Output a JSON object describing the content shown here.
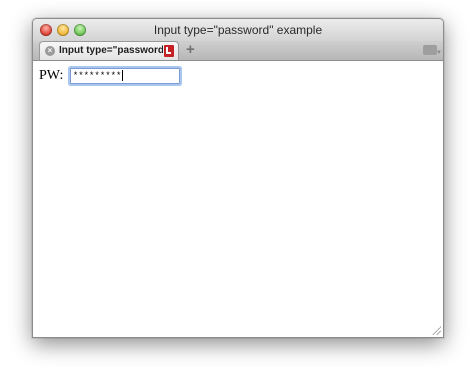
{
  "window": {
    "title": "Input type=\"password\" example"
  },
  "tabs": [
    {
      "label": "Input type=\"password...",
      "close_glyph": "×",
      "favicon": "bookmark-icon"
    }
  ],
  "tabstrip": {
    "new_tab_glyph": "+",
    "menu_icon": "tab-overview-icon"
  },
  "form": {
    "password_label": "PW:",
    "password_value": "*********"
  },
  "colors": {
    "focus_ring": "#a9c6ef",
    "close_light": "#e0443a",
    "minimize_light": "#f0b93a",
    "zoom_light": "#6fc85a",
    "favicon": "#c52024"
  }
}
